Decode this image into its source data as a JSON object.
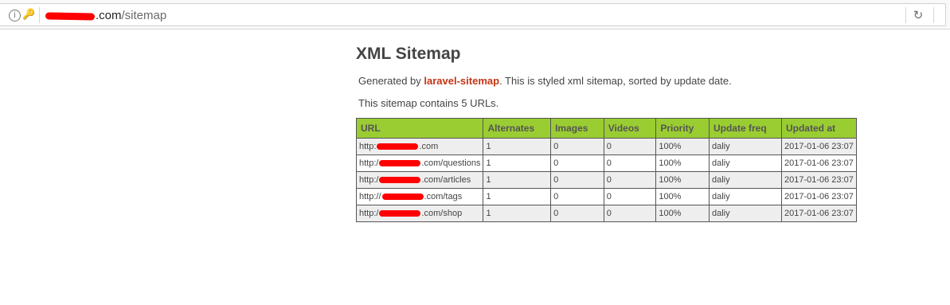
{
  "browser": {
    "url_host_suffix": ".com",
    "url_path": "/sitemap",
    "info_icon": "info-icon",
    "key_icon": "key-icon",
    "reload_icon": "reload-icon"
  },
  "page": {
    "title": "XML Sitemap",
    "generated_prefix": "Generated by ",
    "generator_link": "laravel-sitemap",
    "generated_suffix": ". This is styled xml sitemap, sorted by update date.",
    "count_text": "This sitemap contains 5 URLs."
  },
  "table": {
    "headers": [
      "URL",
      "Alternates",
      "Images",
      "Videos",
      "Priority",
      "Update freq",
      "Updated at"
    ],
    "rows": [
      {
        "url_prefix": "http:",
        "url_suffix": ".com",
        "alternates": "1",
        "images": "0",
        "videos": "0",
        "priority": "100%",
        "freq": "daliy",
        "updated": "2017-01-06 23:07"
      },
      {
        "url_prefix": "http:/",
        "url_suffix": ".com/questions",
        "alternates": "1",
        "images": "0",
        "videos": "0",
        "priority": "100%",
        "freq": "daliy",
        "updated": "2017-01-06 23:07"
      },
      {
        "url_prefix": "http:/",
        "url_suffix": ".com/articles",
        "alternates": "1",
        "images": "0",
        "videos": "0",
        "priority": "100%",
        "freq": "daliy",
        "updated": "2017-01-06 23:07"
      },
      {
        "url_prefix": "http://",
        "url_suffix": ".com/tags",
        "alternates": "1",
        "images": "0",
        "videos": "0",
        "priority": "100%",
        "freq": "daliy",
        "updated": "2017-01-06 23:07"
      },
      {
        "url_prefix": "http:/",
        "url_suffix": ".com/shop",
        "alternates": "1",
        "images": "0",
        "videos": "0",
        "priority": "100%",
        "freq": "daliy",
        "updated": "2017-01-06 23:07"
      }
    ]
  },
  "colors": {
    "header_bg": "#9acd32",
    "link": "#c53414",
    "redaction": "#ff0000"
  }
}
